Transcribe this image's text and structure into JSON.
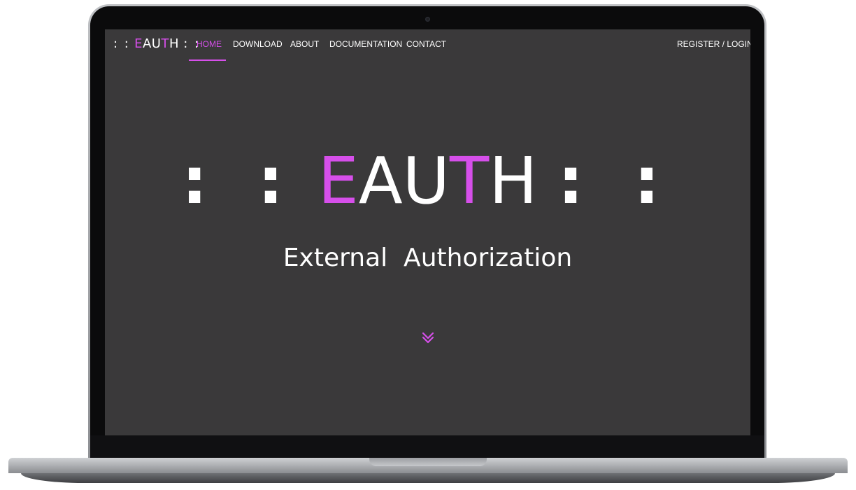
{
  "nav": {
    "brand": {
      "dots_left": ": :",
      "e": "E",
      "a": "A",
      "u": "U",
      "t": "T",
      "h": "H",
      "dots_right": ": :"
    },
    "items": [
      {
        "label": "HOME",
        "active": true
      },
      {
        "label": "DOWNLOAD",
        "active": false
      },
      {
        "label": "ABOUT",
        "active": false
      },
      {
        "label": "DOCUMENTATION",
        "active": false
      },
      {
        "label": "CONTACT",
        "active": false
      }
    ],
    "register_login": "REGISTER / LOGIN"
  },
  "hero": {
    "title": {
      "dots_left": ": :",
      "e": "E",
      "au": "AU",
      "t": "T",
      "h": "H",
      "dots_right": ": :"
    },
    "subtitle": "External  Authorization",
    "scroll_icon": "double-chevron-down-icon"
  },
  "colors": {
    "accent": "#d64fea",
    "screen_bg": "#3a393a",
    "text": "#ffffff"
  }
}
